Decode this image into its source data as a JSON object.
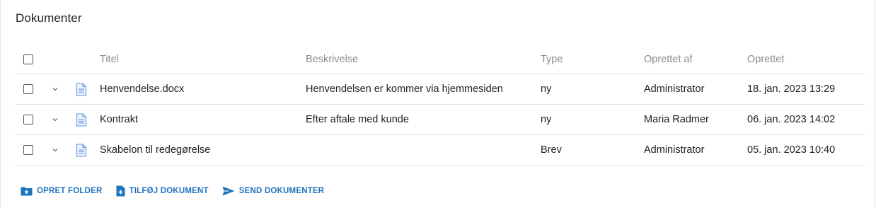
{
  "panel": {
    "title": "Dokumenter"
  },
  "table": {
    "columns": {
      "title": "Titel",
      "description": "Beskrivelse",
      "type": "Type",
      "created_by": "Oprettet af",
      "created": "Oprettet"
    },
    "rows": [
      {
        "title": "Henvendelse.docx",
        "description": "Henvendelsen er kommer via hjemmesiden",
        "type": "ny",
        "created_by": "Administrator",
        "created": "18. jan. 2023 13:29",
        "icon": "document-icon"
      },
      {
        "title": "Kontrakt",
        "description": "Efter aftale med kunde",
        "type": "ny",
        "created_by": "Maria Radmer",
        "created": "06. jan. 2023 14:02",
        "icon": "document-icon"
      },
      {
        "title": "Skabelon til redegørelse",
        "description": "",
        "type": "Brev",
        "created_by": "Administrator",
        "created": "05. jan. 2023 10:40",
        "icon": "document-icon"
      }
    ]
  },
  "actions": {
    "create_folder": "OPRET FOLDER",
    "add_document": "TILFØJ DOKUMENT",
    "send_documents": "SEND DOKUMENTER"
  },
  "colors": {
    "accent": "#1e73be",
    "file_icon": "#7aa3e0",
    "header_text": "#8a8a8a"
  }
}
